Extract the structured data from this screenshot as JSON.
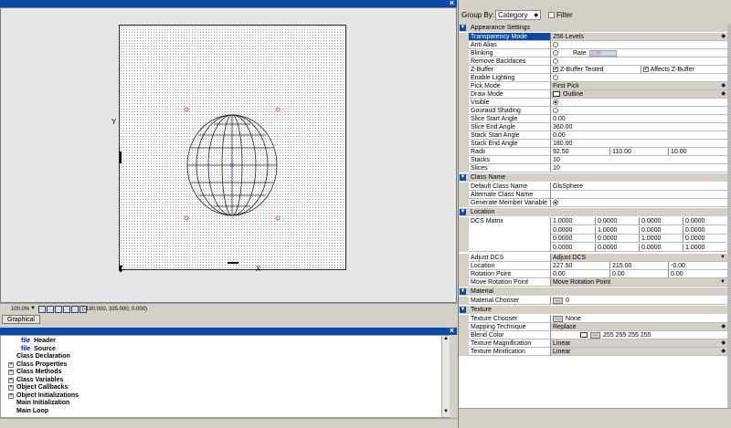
{
  "canvas": {
    "axis_y": "Y",
    "axis_x": "X",
    "axis_z": "Z"
  },
  "statusbar": {
    "zoom": "100.0%",
    "coords": "(-190.000, 335.000, 0.000)"
  },
  "tabs": {
    "graphical": "Graphical"
  },
  "tree": {
    "items": [
      {
        "prefix": "file",
        "label": "Header",
        "expander": false
      },
      {
        "prefix": "file",
        "label": "Source",
        "expander": false
      },
      {
        "prefix": "",
        "label": "Class Declaration",
        "expander": false
      },
      {
        "prefix": "",
        "label": "Class Properties",
        "expander": true
      },
      {
        "prefix": "",
        "label": "Class Methods",
        "expander": true
      },
      {
        "prefix": "",
        "label": "Class Variables",
        "expander": true
      },
      {
        "prefix": "",
        "label": "Object Callbacks",
        "expander": true
      },
      {
        "prefix": "",
        "label": "Object Initializations",
        "expander": true
      },
      {
        "prefix": "",
        "label": "Main Initialization",
        "expander": false
      },
      {
        "prefix": "",
        "label": "Main Loop",
        "expander": false
      }
    ]
  },
  "groupbar": {
    "label": "Group By:",
    "value": "Category",
    "filter_label": "Filter"
  },
  "props": {
    "appearance": {
      "title": "Appearance Settings",
      "transparency_mode": {
        "name": "Transparency Mode",
        "value": "256 Levels"
      },
      "anti_alias": {
        "name": "Anti Alias"
      },
      "blinking": {
        "name": "Blinking",
        "rate_label": "Rate",
        "rate_value": "2.00"
      },
      "remove_backfaces": {
        "name": "Remove Backfaces"
      },
      "zbuffer": {
        "name": "Z-Buffer",
        "opt1": "Z-Buffer Tested",
        "opt2": "Affects Z-Buffer"
      },
      "enable_lighting": {
        "name": "Enable Lighting"
      },
      "pick_mode": {
        "name": "Pick Mode",
        "value": "First Pick"
      },
      "draw_mode": {
        "name": "Draw Mode",
        "value": "Outline"
      },
      "visible": {
        "name": "Visible"
      },
      "gouraud": {
        "name": "Gouraud Shading"
      },
      "slice_start": {
        "name": "Slice Start Angle",
        "value": "0.00"
      },
      "slice_end": {
        "name": "Slice End Angle",
        "value": "360.00"
      },
      "stack_start": {
        "name": "Stack Start Angle",
        "value": "0.00"
      },
      "stack_end": {
        "name": "Stack End Angle",
        "value": "180.00"
      },
      "radii": {
        "name": "Radii",
        "v1": "92.50",
        "v2": "110.00",
        "v3": "10.00"
      },
      "stacks": {
        "name": "Stacks",
        "value": "10"
      },
      "slices": {
        "name": "Slices",
        "value": "10"
      }
    },
    "classname": {
      "title": "Class Name",
      "default_name": {
        "name": "Default Class Name",
        "value": "GlsSphere"
      },
      "alternate_name": {
        "name": "Alternate Class Name",
        "value": ""
      },
      "generate_member": {
        "name": "Generate Member Variable"
      }
    },
    "location": {
      "title": "Location",
      "dcs_matrix": {
        "name": "DCS Matrix",
        "rows": [
          [
            "1.0000",
            "0.0000",
            "0.0000",
            "0.0000"
          ],
          [
            "0.0000",
            "1.0000",
            "0.0000",
            "0.0000"
          ],
          [
            "0.0000",
            "0.0000",
            "1.0000",
            "0.0000"
          ],
          [
            "0.0000",
            "0.0000",
            "0.0000",
            "1.0000"
          ]
        ]
      },
      "adjust_dcs": {
        "name": "Adjust DCS",
        "value": "Adjust DCS"
      },
      "location": {
        "name": "Location",
        "v1": "227.50",
        "v2": "215.00",
        "v3": "-0.00"
      },
      "rotation_point": {
        "name": "Rotation Point",
        "v1": "0.00",
        "v2": "0.00",
        "v3": "0.00"
      },
      "move_rotation_point": {
        "name": "Move Rotation Point",
        "value": "Move Rotation Point"
      }
    },
    "material": {
      "title": "Material",
      "chooser": {
        "name": "Material Chooser",
        "btn": "...",
        "value": "0"
      }
    },
    "texture": {
      "title": "Texture",
      "chooser": {
        "name": "Texture Chooser",
        "btn": "...",
        "value": "None"
      },
      "mapping": {
        "name": "Mapping Technique",
        "value": "Replace"
      },
      "blend": {
        "name": "Blend Color",
        "btn": "...",
        "value": "255 255 255 255"
      },
      "magnification": {
        "name": "Texture Magnification",
        "value": "Linear"
      },
      "minification": {
        "name": "Texture Minification",
        "value": "Linear"
      }
    }
  }
}
